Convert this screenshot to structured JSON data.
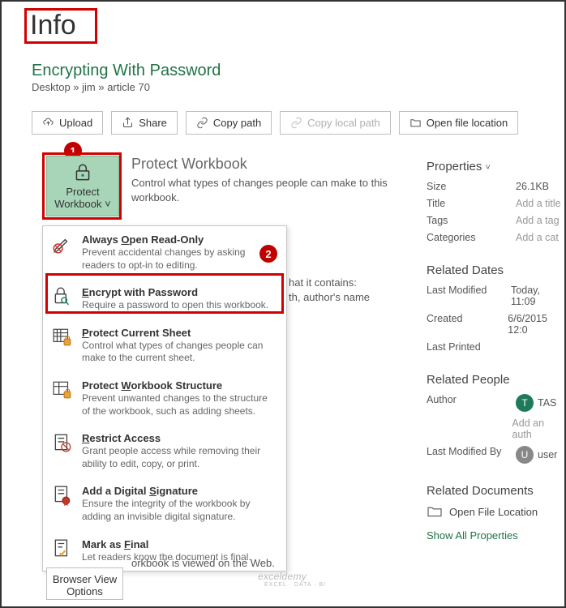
{
  "page_title": "Info",
  "file_title": "Encrypting With Password",
  "breadcrumb": "Desktop » jim » article 70",
  "toolbar": {
    "upload": "Upload",
    "share": "Share",
    "copy_path": "Copy path",
    "copy_local_path": "Copy local path",
    "open_location": "Open file location"
  },
  "badges": {
    "one": "1",
    "two": "2"
  },
  "protect_button": {
    "line1": "Protect",
    "line2": "Workbook"
  },
  "protect_section": {
    "heading": "Protect Workbook",
    "desc": "Control what types of changes people can make to this workbook."
  },
  "dropdown": [
    {
      "title_pre": "Always ",
      "title_u": "O",
      "title_post": "pen Read-Only",
      "desc": "Prevent accidental changes by asking readers to opt-in to editing."
    },
    {
      "title_pre": "",
      "title_u": "E",
      "title_post": "ncrypt with Password",
      "desc": "Require a password to open this workbook."
    },
    {
      "title_pre": "",
      "title_u": "P",
      "title_post": "rotect Current Sheet",
      "desc": "Control what types of changes people can make to the current sheet."
    },
    {
      "title_pre": "Protect ",
      "title_u": "W",
      "title_post": "orkbook Structure",
      "desc": "Prevent unwanted changes to the structure of the workbook, such as adding sheets."
    },
    {
      "title_pre": "",
      "title_u": "R",
      "title_post": "estrict Access",
      "desc": "Grant people access while removing their ability to edit, copy, or print."
    },
    {
      "title_pre": "Add a Digital ",
      "title_u": "S",
      "title_post": "ignature",
      "desc": "Ensure the integrity of the workbook by adding an invisible digital signature."
    },
    {
      "title_pre": "Mark as ",
      "title_u": "F",
      "title_post": "inal",
      "desc": "Let readers know the document is final."
    }
  ],
  "partial": {
    "line1": "hat it contains:",
    "line2": "th, author's name"
  },
  "browser_text": "orkbook is viewed on the Web.",
  "browser_button": {
    "l1": "Browser View",
    "l2": "Options"
  },
  "properties": {
    "heading": "Properties",
    "rows": [
      {
        "label": "Size",
        "value": "26.1KB"
      },
      {
        "label": "Title",
        "placeholder": "Add a title"
      },
      {
        "label": "Tags",
        "placeholder": "Add a tag"
      },
      {
        "label": "Categories",
        "placeholder": "Add a cat"
      }
    ]
  },
  "related_dates": {
    "heading": "Related Dates",
    "rows": [
      {
        "label": "Last Modified",
        "value": "Today, 11:09"
      },
      {
        "label": "Created",
        "value": "6/6/2015 12:0"
      },
      {
        "label": "Last Printed",
        "value": ""
      }
    ]
  },
  "related_people": {
    "heading": "Related People",
    "author_label": "Author",
    "author_initial": "T",
    "author_name": "TAS",
    "add_author": "Add an auth",
    "last_mod_label": "Last Modified By",
    "last_mod_initial": "U",
    "last_mod_name": "user"
  },
  "related_docs": {
    "heading": "Related Documents",
    "open": "Open File Location",
    "show_all": "Show All Properties"
  },
  "watermark": {
    "main": "exceldemy",
    "sub": "EXCEL · DATA · BI"
  }
}
